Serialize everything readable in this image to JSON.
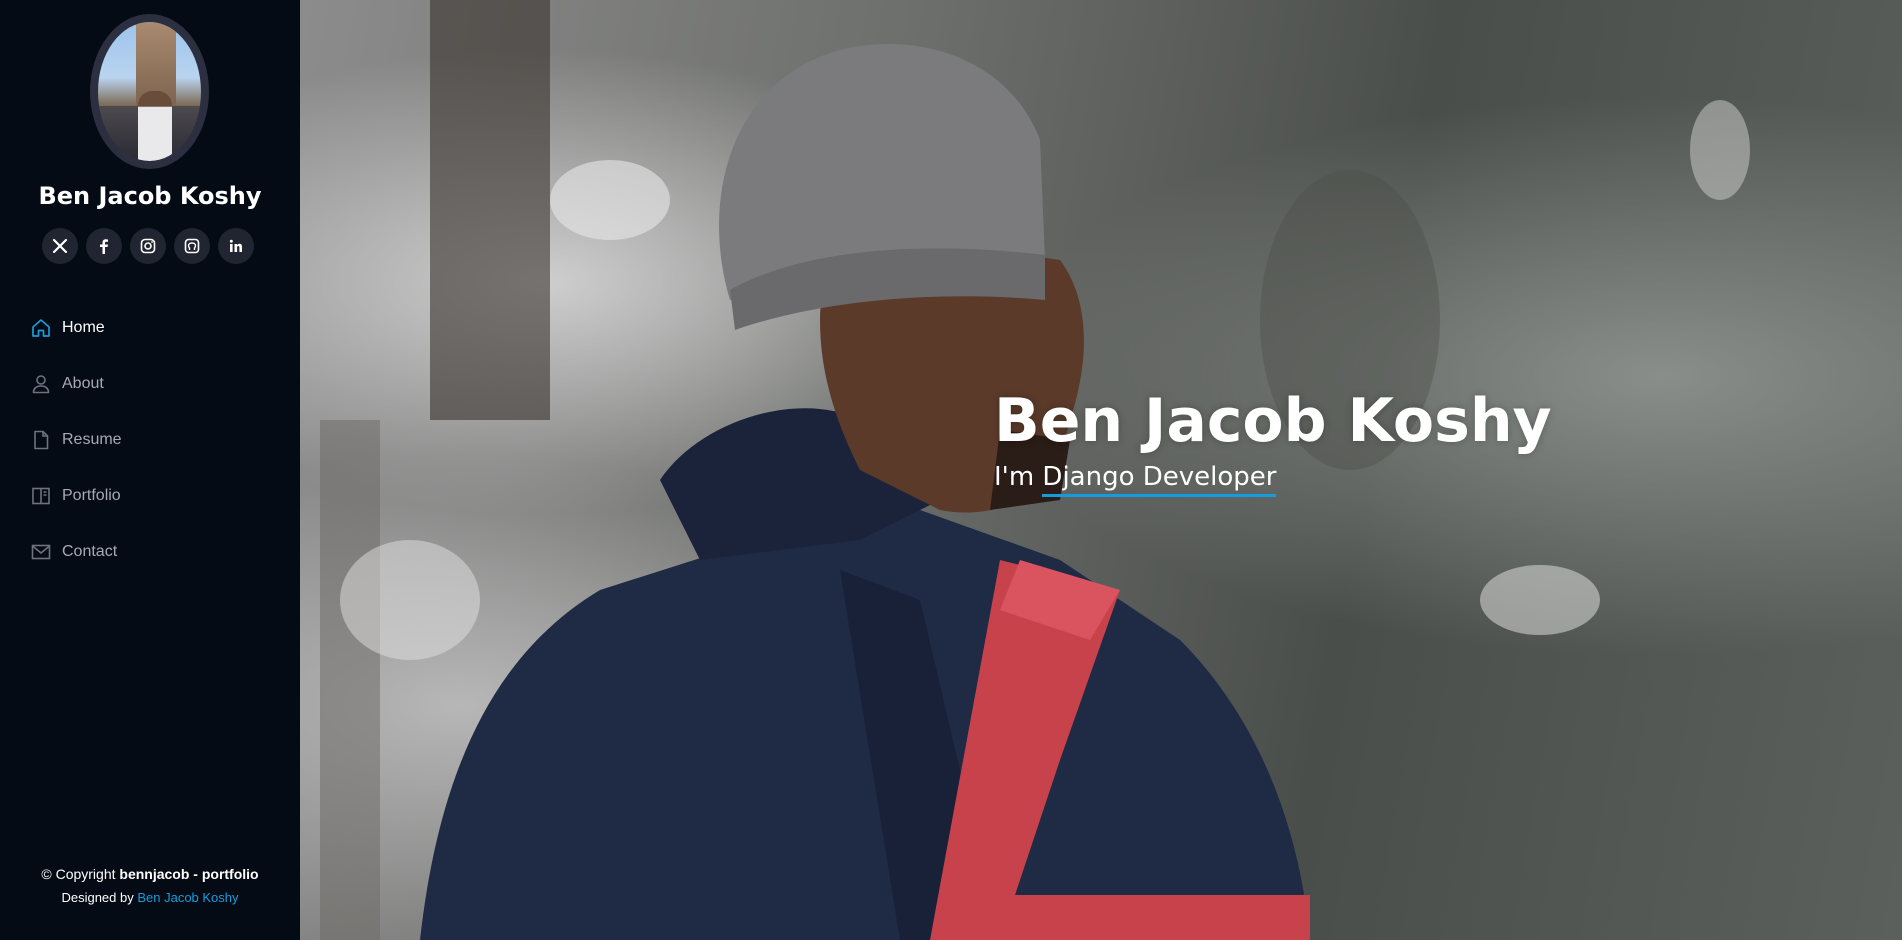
{
  "profile": {
    "name": "Ben Jacob Koshy"
  },
  "social": [
    {
      "icon": "x-twitter-icon",
      "glyph": "𝕏"
    },
    {
      "icon": "facebook-icon",
      "glyph": "f"
    },
    {
      "icon": "instagram-icon",
      "glyph": "◎"
    },
    {
      "icon": "github-icon",
      "glyph": "◉"
    },
    {
      "icon": "linkedin-icon",
      "glyph": "in"
    }
  ],
  "nav": {
    "items": [
      {
        "label": "Home",
        "icon": "house-icon",
        "active": true
      },
      {
        "label": "About",
        "icon": "person-icon",
        "active": false
      },
      {
        "label": "Resume",
        "icon": "file-icon",
        "active": false
      },
      {
        "label": "Portfolio",
        "icon": "book-icon",
        "active": false
      },
      {
        "label": "Contact",
        "icon": "envelope-icon",
        "active": false
      }
    ]
  },
  "footer": {
    "copyright_prefix": "© Copyright ",
    "copyright_owner": "bennjacob - portfolio",
    "designed_prefix": "Designed by ",
    "designer": "Ben Jacob Koshy"
  },
  "hero": {
    "title": "Ben Jacob Koshy",
    "subtitle_prefix": "I'm ",
    "subtitle_typed": "Django Developer"
  },
  "colors": {
    "accent": "#149ddd",
    "sidebar_bg": "#040b14",
    "social_bg": "#212431",
    "nav_text": "#a8a9b4"
  }
}
